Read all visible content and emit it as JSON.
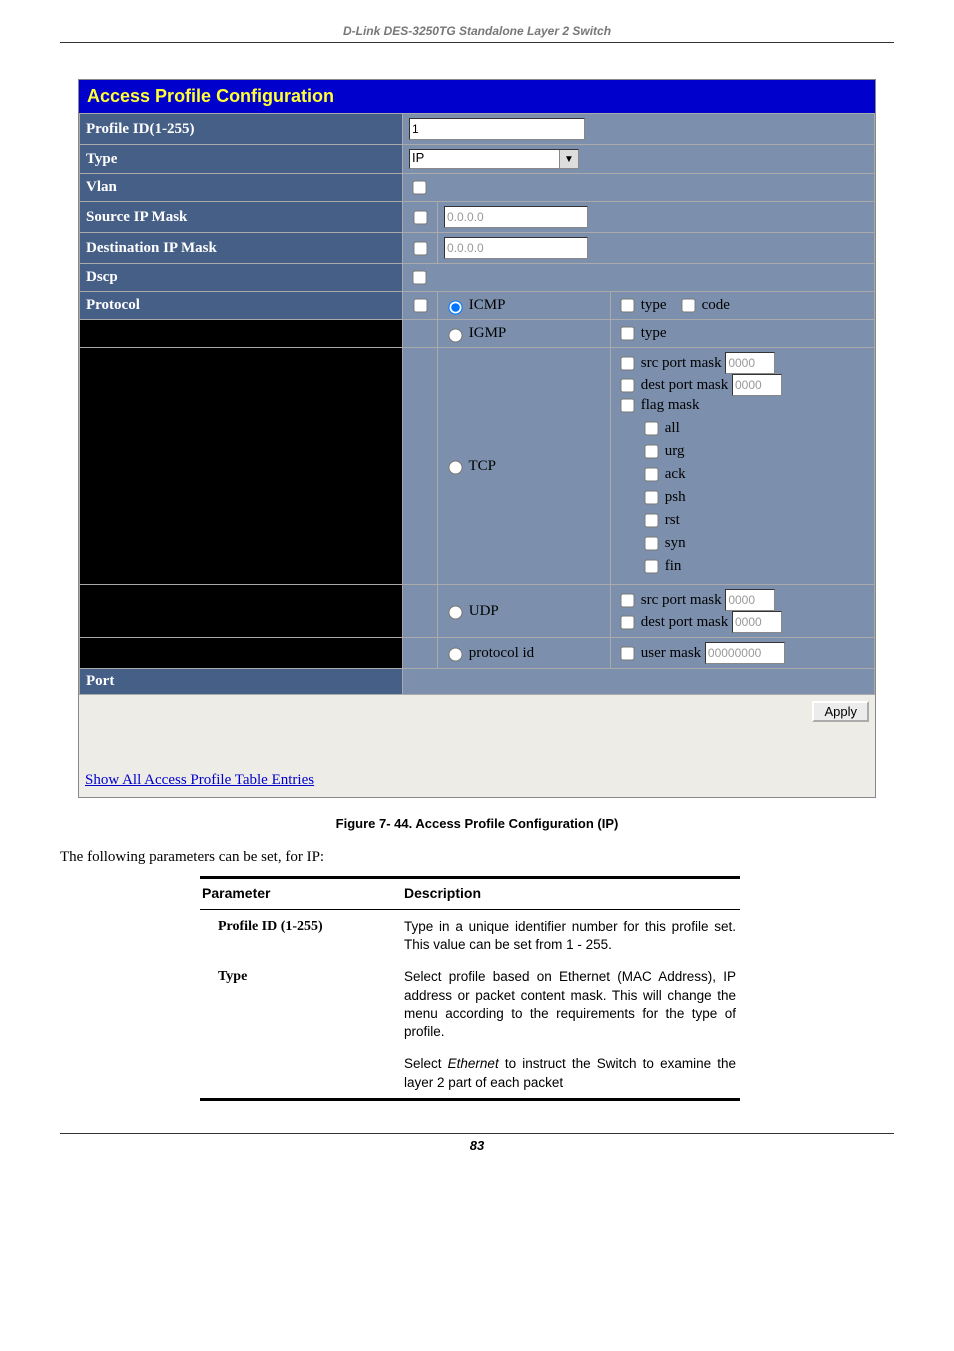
{
  "header": {
    "product_line": "D-Link DES-3250TG Standalone Layer 2 Switch"
  },
  "config_panel": {
    "title": "Access Profile Configuration",
    "rows": {
      "profile_id_label": "Profile ID(1-255)",
      "profile_id_value": "1",
      "type_label": "Type",
      "type_value": "IP",
      "vlan_label": "Vlan",
      "src_ip_label": "Source IP Mask",
      "src_ip_value": "0.0.0.0",
      "dst_ip_label": "Destination IP Mask",
      "dst_ip_value": "0.0.0.0",
      "dscp_label": "Dscp",
      "protocol_label": "Protocol",
      "icmp_label": "ICMP",
      "icmp_type": "type",
      "icmp_code": "code",
      "igmp_label": "IGMP",
      "igmp_type": "type",
      "tcp_label": "TCP",
      "tcp_src_label": "src port mask",
      "tcp_src_value": "0000",
      "tcp_dst_label": "dest port mask",
      "tcp_dst_value": "0000",
      "tcp_flag_label": "flag mask",
      "tcp_flags": {
        "all": "all",
        "urg": "urg",
        "ack": "ack",
        "psh": "psh",
        "rst": "rst",
        "syn": "syn",
        "fin": "fin"
      },
      "udp_label": "UDP",
      "udp_src_label": "src port mask",
      "udp_src_value": "0000",
      "udp_dst_label": "dest port mask",
      "udp_dst_value": "0000",
      "protoid_label": "protocol id",
      "protoid_user_label": "user mask",
      "protoid_user_value": "00000000",
      "port_label": "Port"
    },
    "apply_label": "Apply",
    "link_text": "Show All Access Profile Table Entries"
  },
  "figure_caption": "Figure 7- 44. Access Profile Configuration (IP)",
  "intro_text": "The following parameters can be set, for IP:",
  "param_table": {
    "header_param": "Parameter",
    "header_desc": "Description",
    "rows": [
      {
        "name": "Profile ID (1-255)",
        "desc": "Type in a unique identifier number for this profile set. This value can be set from 1 - 255."
      },
      {
        "name": "Type",
        "desc1": "Select profile based on Ethernet (MAC Address), IP address or packet content mask. This will change the menu according to the requirements for the type of profile.",
        "desc2a": "Select ",
        "desc2_kw": "Ethernet",
        "desc2b": " to instruct the Switch to examine the layer 2 part of each packet"
      }
    ]
  },
  "page_number": "83"
}
